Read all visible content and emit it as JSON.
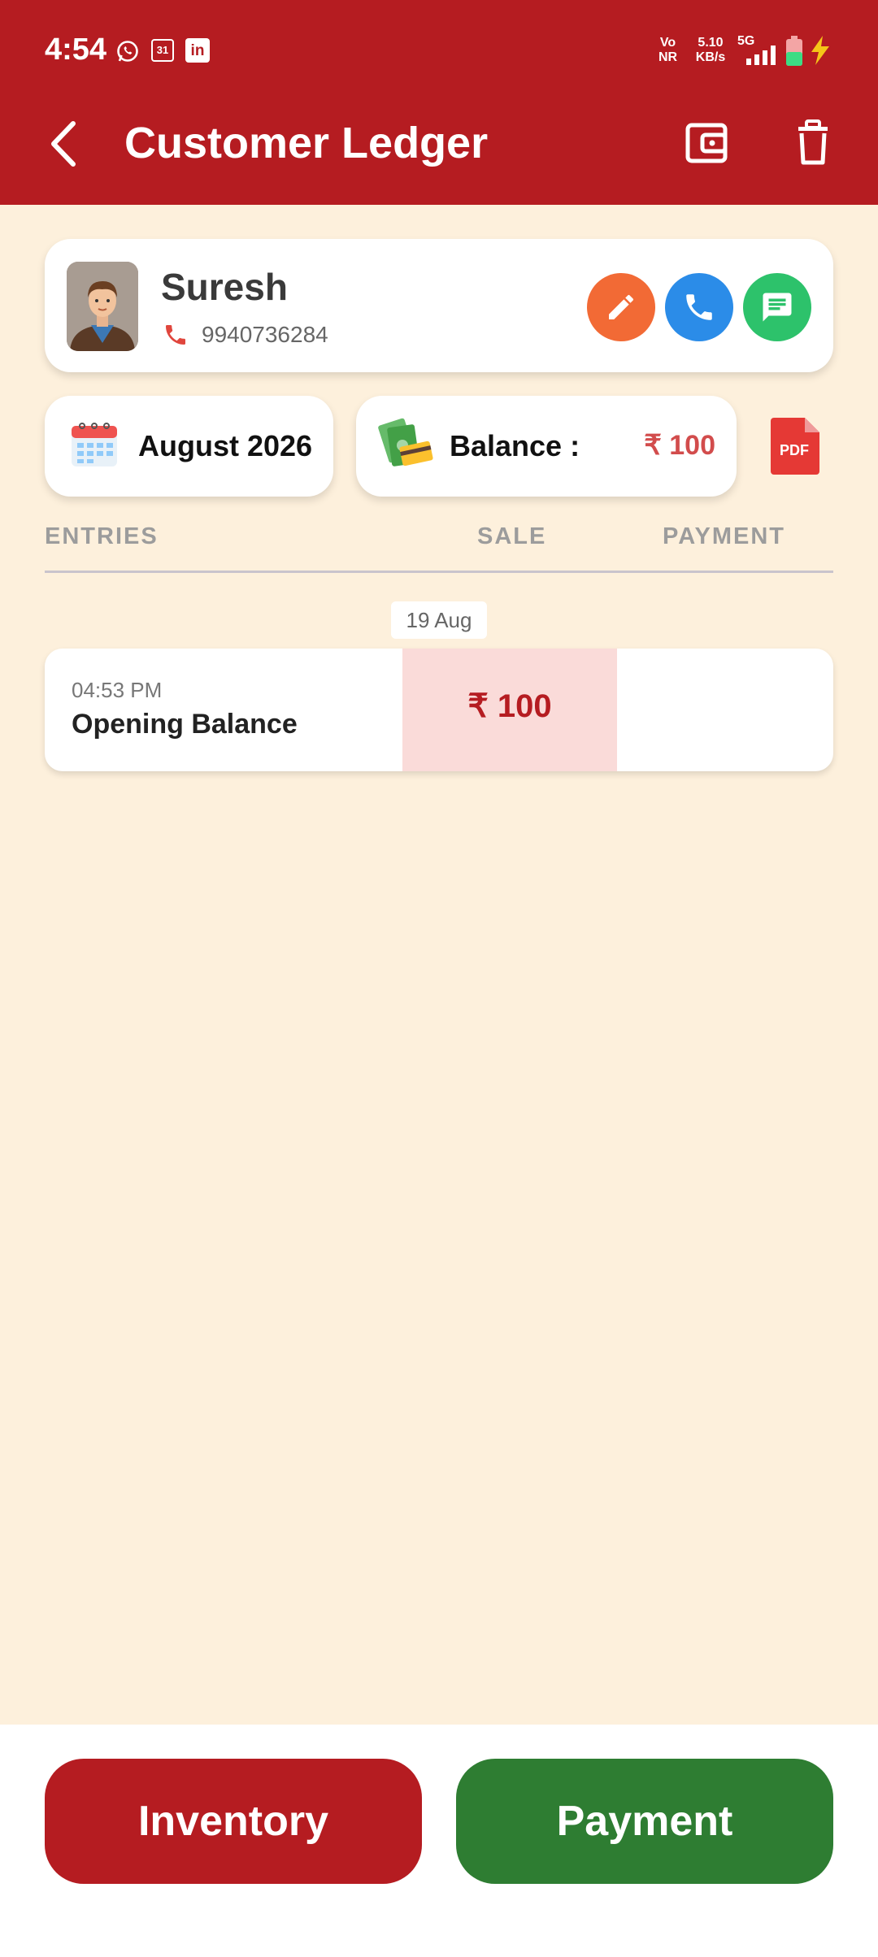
{
  "status_bar": {
    "time": "4:54",
    "calendar_badge": "31",
    "net_type_top": "Vo",
    "net_type_bottom": "NR",
    "speed_value": "5.10",
    "speed_unit": "KB/s",
    "signal_label": "5G",
    "icons": [
      "whatsapp-icon",
      "calendar-icon",
      "linkedin-icon",
      "signal-icon",
      "battery-icon",
      "charging-icon"
    ]
  },
  "header": {
    "title": "Customer Ledger",
    "back_icon": "chevron-left-icon",
    "actions": [
      "wallet-icon",
      "trash-icon"
    ]
  },
  "customer": {
    "name": "Suresh",
    "phone": "9940736284",
    "actions": [
      {
        "name": "edit",
        "icon": "pencil-icon",
        "color": "#f26a35"
      },
      {
        "name": "call",
        "icon": "phone-icon",
        "color": "#2b8ce8"
      },
      {
        "name": "message",
        "icon": "message-icon",
        "color": "#2dc26b"
      }
    ]
  },
  "summary": {
    "month": "August 2026",
    "balance_label": "Balance :",
    "balance_value": "₹ 100",
    "pdf_label": "PDF"
  },
  "columns": {
    "entries": "ENTRIES",
    "sale": "SALE",
    "payment": "PAYMENT"
  },
  "groups": [
    {
      "date": "19 Aug",
      "entries": [
        {
          "time": "04:53 PM",
          "label": "Opening Balance",
          "sale": "₹ 100",
          "payment": ""
        }
      ]
    }
  ],
  "footer": {
    "inventory_label": "Inventory",
    "payment_label": "Payment"
  },
  "colors": {
    "primary_red": "#b51c21",
    "background": "#fdf0dc",
    "payment_green": "#2e7d32",
    "sale_highlight": "#fadbd9",
    "balance_text": "#d24c4c"
  }
}
